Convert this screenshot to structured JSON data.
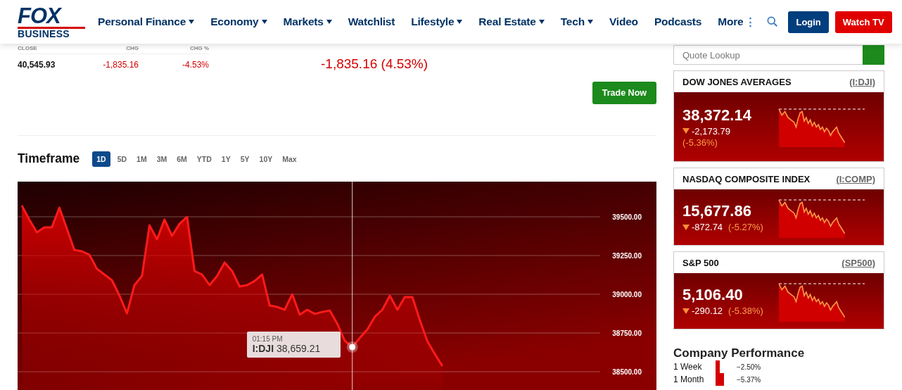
{
  "header": {
    "logo_top": "FOX",
    "logo_bottom": "BUSINESS",
    "nav": [
      {
        "label": "Personal Finance",
        "dropdown": true
      },
      {
        "label": "Economy",
        "dropdown": true
      },
      {
        "label": "Markets",
        "dropdown": true
      },
      {
        "label": "Watchlist",
        "dropdown": false
      },
      {
        "label": "Lifestyle",
        "dropdown": true
      },
      {
        "label": "Real Estate",
        "dropdown": true
      },
      {
        "label": "Tech",
        "dropdown": true
      },
      {
        "label": "Video",
        "dropdown": false
      },
      {
        "label": "Podcasts",
        "dropdown": false
      },
      {
        "label": "More",
        "dropdown": false
      }
    ],
    "more_icon": "⋮",
    "login": "Login",
    "watch": "Watch TV"
  },
  "stats": {
    "columns": [
      "CLOSE",
      "CHG",
      "CHG %"
    ],
    "values": [
      {
        "text": "40,545.93",
        "negative": false
      },
      {
        "text": "-1,835.16",
        "negative": true
      },
      {
        "text": "-4.53%",
        "negative": true
      }
    ]
  },
  "change": "-1,835.16 (4.53%)",
  "trade_button": "Trade Now",
  "timeframe": {
    "title": "Timeframe",
    "options": [
      {
        "label": "1D",
        "selected": true
      },
      {
        "label": "5D",
        "selected": false
      },
      {
        "label": "1M",
        "selected": false
      },
      {
        "label": "3M",
        "selected": false
      },
      {
        "label": "6M",
        "selected": false
      },
      {
        "label": "YTD",
        "selected": false
      },
      {
        "label": "1Y",
        "selected": false
      },
      {
        "label": "5Y",
        "selected": false
      },
      {
        "label": "10Y",
        "selected": false
      },
      {
        "label": "Max",
        "selected": false
      }
    ]
  },
  "chart_data": {
    "type": "area",
    "grid": true,
    "ylim": [
      38382,
      39727
    ],
    "yticks": [
      {
        "value": 39500,
        "label": "39500.00"
      },
      {
        "value": 39250,
        "label": "39250.00"
      },
      {
        "value": 39000,
        "label": "39000.00"
      },
      {
        "value": 38750,
        "label": "38750.00"
      },
      {
        "value": 38500,
        "label": "38500.00"
      }
    ],
    "series": [
      {
        "name": "I:DJI",
        "color": "#ff1a1a",
        "values": [
          39573,
          39482,
          39400,
          39432,
          39432,
          39559,
          39423,
          39286,
          39277,
          39255,
          39164,
          39127,
          39091,
          38991,
          38877,
          39059,
          39118,
          39445,
          39355,
          39482,
          39377,
          39455,
          39500,
          39150,
          39127,
          39059,
          39118,
          39205,
          39150,
          39050,
          39059,
          39086,
          39127,
          38927,
          38918,
          38900,
          39000,
          38868,
          38900,
          38873,
          38886,
          38895,
          38809,
          38700,
          38659,
          38718,
          38773,
          38855,
          38900,
          38991,
          38900,
          38982,
          38982,
          38832,
          38695,
          38614,
          38536,
          null,
          null,
          null,
          null,
          null,
          null,
          null,
          null,
          null,
          null,
          null,
          null,
          null,
          null,
          null,
          null,
          null,
          null,
          null,
          null,
          null
        ]
      }
    ]
  },
  "tooltip": {
    "time": "01:15 PM",
    "value": "38,659.21"
  },
  "sidebar": {
    "search_placeholder": "Quote Lookup",
    "indices": [
      {
        "name": "DOW JONES AVERAGES",
        "symbol": "(I:DJI)",
        "price": "38,372.14",
        "change": "-2,173.79",
        "percent": "(-5.36%)",
        "wrap": true
      },
      {
        "name": "NASDAQ COMPOSITE INDEX",
        "symbol": "(I:COMP)",
        "price": "15,677.86",
        "change": "-872.74",
        "percent": "(-5.27%)",
        "wrap": false
      },
      {
        "name": "S&P 500",
        "symbol": "(SP500)",
        "price": "5,106.40",
        "change": "-290.12",
        "percent": "(-5.38%)",
        "wrap": false
      }
    ],
    "performance": {
      "title": "Company Performance",
      "rows": [
        {
          "label": "1 Week",
          "value": "−2.50%"
        },
        {
          "label": "1 Month",
          "value": "−5.37%"
        }
      ]
    }
  }
}
